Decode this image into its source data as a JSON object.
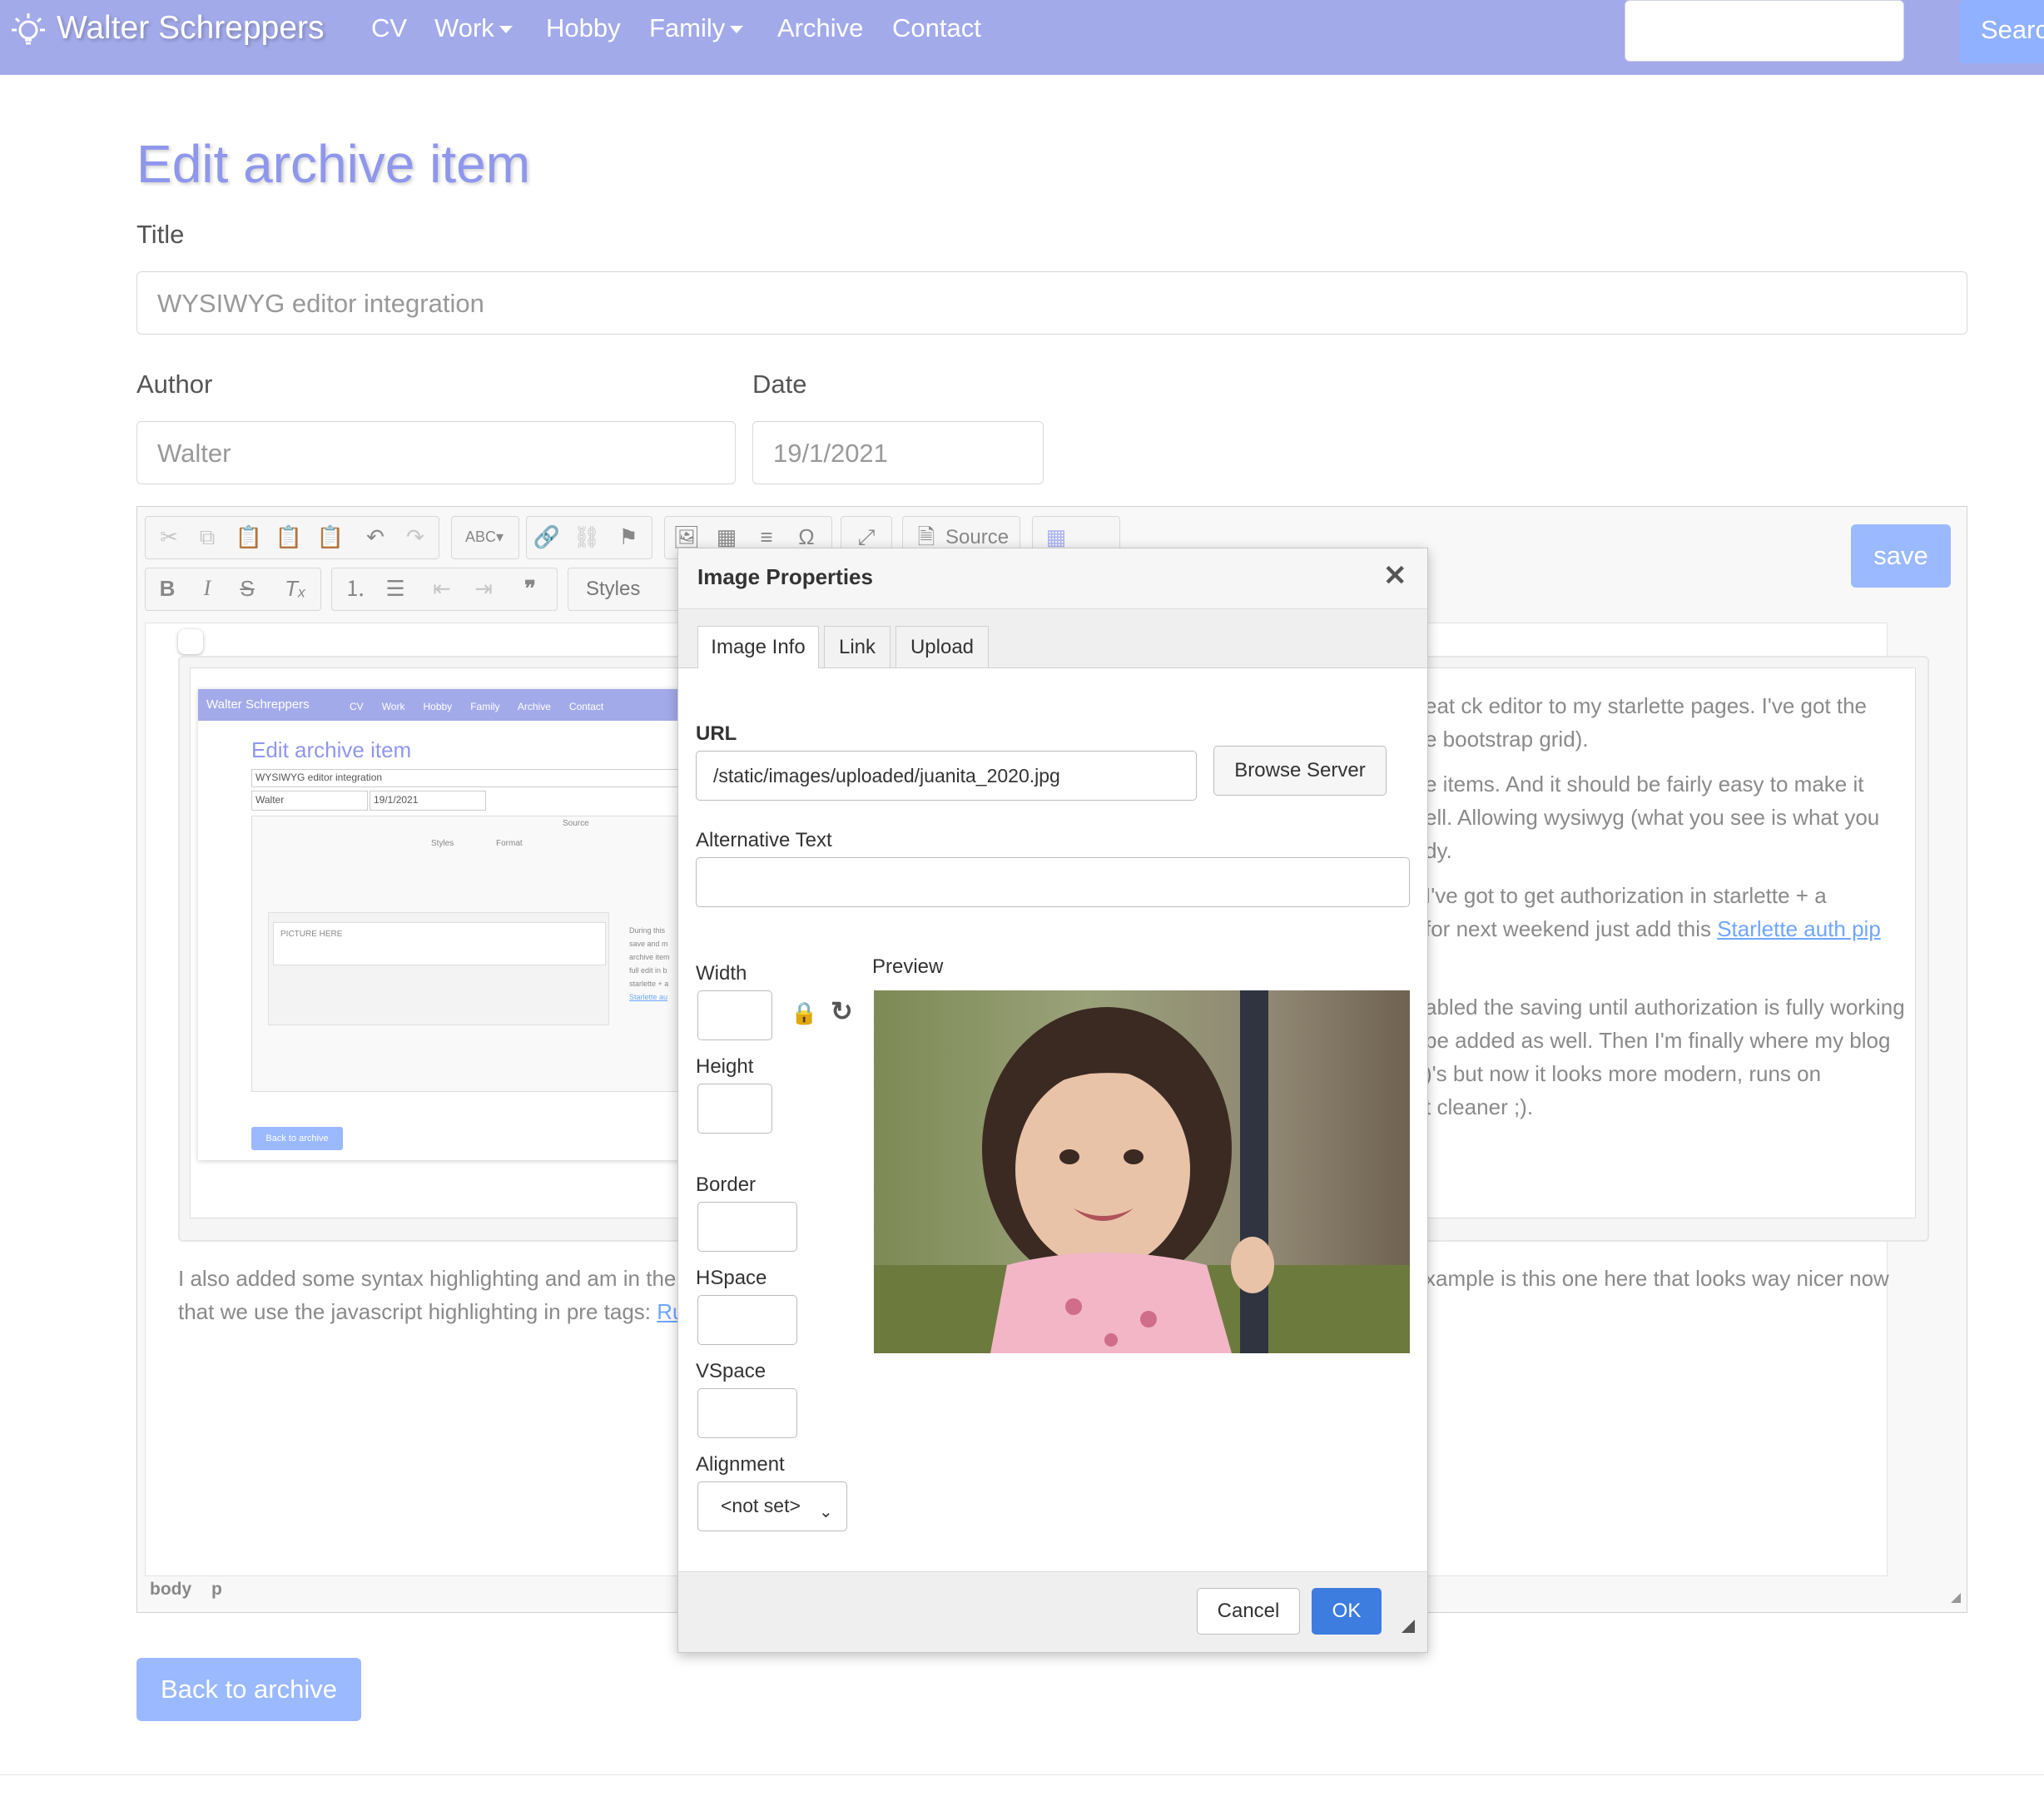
{
  "navbar": {
    "brand": "Walter Schreppers",
    "links": [
      "CV",
      "Work",
      "Hobby",
      "Family",
      "Archive",
      "Contact"
    ],
    "search_button": "Searc"
  },
  "page": {
    "title": "Edit archive item",
    "labels": {
      "title": "Title",
      "author": "Author",
      "date": "Date"
    },
    "values": {
      "title": "WYSIWYG editor integration",
      "author": "Walter",
      "date": "19/1/2021"
    },
    "save_button": "save",
    "back_button": "Back to archive"
  },
  "editor": {
    "toolbar": {
      "source_label": "Source",
      "styles_label": "Styles"
    },
    "status_path": [
      "body",
      "p"
    ],
    "content": {
      "right_lines": [
        "eat ck editor to my starlette pages. I've got the",
        "e bootstrap grid).",
        "e items. And it should be fairly easy to make it",
        "ell. Allowing wysiwyg (what you see is what you",
        "dy.",
        "I've got to get authorization in starlette + a",
        "for next weekend just add this ",
        "abled the saving until authorization is fully working",
        "be added as well. Then I'm finally where my blog",
        ")'s but now it looks more modern, runs on",
        "t cleaner ;)."
      ],
      "right_link": "Starlette auth pip ",
      "bottom_left_1": "I also added some syntax highlighting and am in the",
      "bottom_left_2": "that we use the javascript highlighting in pre tags: ",
      "bottom_left_link": "Ru",
      "bottom_right": "xample is this one here that looks way nicer now"
    },
    "embedded_screenshot": {
      "brand": "Walter Schreppers",
      "links": [
        "CV",
        "Work",
        "Hobby",
        "Family",
        "Archive",
        "Contact"
      ],
      "title": "Edit archive item",
      "title_value": "WYSIWYG editor integration",
      "author_value": "Walter",
      "date_value": "19/1/2021",
      "picture_placeholder": "PICTURE HERE",
      "side_lines": [
        "During this",
        "save and m",
        "archive item",
        "full edit in b",
        "starlette + a"
      ],
      "side_link": "Starlette au",
      "back_button": "Back to archive",
      "toolbar_source": "Source",
      "toolbar_styles": "Styles",
      "toolbar_format": "Format"
    }
  },
  "dialog": {
    "title": "Image Properties",
    "tabs": [
      "Image Info",
      "Link",
      "Upload"
    ],
    "active_tab": "Image Info",
    "url_label": "URL",
    "url_value": "/static/images/uploaded/juanita_2020.jpg",
    "browse_button": "Browse Server",
    "alt_label": "Alternative Text",
    "alt_value": "",
    "width_label": "Width",
    "height_label": "Height",
    "border_label": "Border",
    "hspace_label": "HSpace",
    "vspace_label": "VSpace",
    "alignment_label": "Alignment",
    "alignment_value": "<not set>",
    "preview_label": "Preview",
    "cancel_button": "Cancel",
    "ok_button": "OK"
  },
  "colors": {
    "navbar": "#a3aaea",
    "title": "#8f97ec",
    "button": "#9bb9ff",
    "ok_button": "#3d7ddf",
    "link": "#6fa6ff"
  }
}
